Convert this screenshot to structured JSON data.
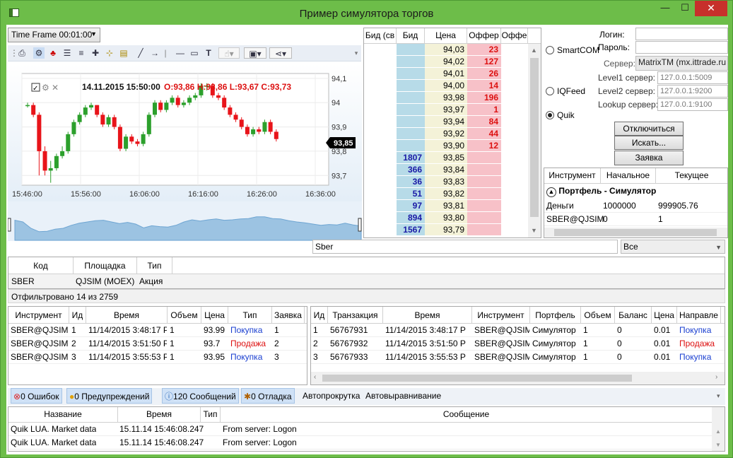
{
  "window": {
    "title": "Пример симулятора торгов",
    "min": "—",
    "max": "☐",
    "close": "✕"
  },
  "timeframe": {
    "label": "Time Frame 00:01:00"
  },
  "chart": {
    "info_date": "14.11.2015 15:50:00",
    "info_ohlc": "O:93,86 H:93,86 L:93,67 C:93,73",
    "last_price": "93,85",
    "price_ticks": [
      "94,1",
      "94",
      "93,9",
      "93,8",
      "93,7"
    ],
    "time_ticks": [
      "15:46:00",
      "15:56:00",
      "16:06:00",
      "16:16:00",
      "16:26:00",
      "16:36:00"
    ]
  },
  "chart_data": {
    "type": "candlestick",
    "x": [
      "15:46",
      "15:47",
      "15:48",
      "15:49",
      "15:50",
      "15:51",
      "15:52",
      "15:53",
      "15:54",
      "15:55",
      "15:56",
      "15:57",
      "15:58",
      "15:59",
      "16:00",
      "16:01",
      "16:02",
      "16:03",
      "16:04",
      "16:05",
      "16:06",
      "16:07",
      "16:08",
      "16:09",
      "16:10",
      "16:11",
      "16:12",
      "16:13",
      "16:14",
      "16:15",
      "16:16",
      "16:17",
      "16:18",
      "16:19",
      "16:20",
      "16:21",
      "16:22",
      "16:23",
      "16:24",
      "16:25",
      "16:26",
      "16:27",
      "16:28",
      "16:29"
    ],
    "open": [
      93.99,
      93.99,
      93.95,
      93.8,
      93.72,
      93.73,
      93.78,
      93.8,
      93.87,
      93.92,
      93.95,
      93.98,
      93.99,
      93.95,
      93.91,
      93.94,
      93.9,
      93.81,
      93.86,
      93.84,
      93.83,
      93.87,
      93.95,
      94.0,
      93.97,
      94.0,
      94.02,
      93.99,
      94.0,
      94.02,
      94.03,
      94.07,
      94.07,
      94.03,
      94.02,
      93.98,
      93.95,
      93.93,
      93.9,
      93.87,
      93.89,
      93.88,
      93.92,
      93.88
    ],
    "close": [
      93.99,
      93.95,
      93.8,
      93.72,
      93.73,
      93.78,
      93.8,
      93.87,
      93.92,
      93.95,
      93.98,
      93.99,
      93.95,
      93.91,
      93.94,
      93.9,
      93.81,
      93.86,
      93.84,
      93.83,
      93.87,
      93.95,
      94.0,
      93.97,
      94.0,
      94.02,
      93.99,
      94.0,
      94.02,
      94.03,
      94.07,
      94.07,
      94.03,
      94.02,
      93.98,
      93.95,
      93.93,
      93.9,
      93.87,
      93.89,
      93.88,
      93.92,
      93.88,
      93.85
    ],
    "high": [
      94.0,
      94.0,
      93.96,
      93.82,
      93.76,
      93.79,
      93.82,
      93.88,
      93.93,
      93.96,
      93.99,
      94.0,
      93.99,
      93.96,
      93.95,
      93.95,
      93.91,
      93.87,
      93.87,
      93.85,
      93.88,
      93.96,
      94.01,
      94.01,
      94.01,
      94.03,
      94.03,
      94.01,
      94.03,
      94.04,
      94.08,
      94.08,
      94.08,
      94.04,
      94.03,
      93.99,
      93.96,
      93.94,
      93.91,
      93.9,
      93.9,
      93.93,
      93.93,
      93.89
    ],
    "low": [
      93.98,
      93.94,
      93.7,
      93.7,
      93.67,
      93.72,
      93.77,
      93.79,
      93.86,
      93.91,
      93.94,
      93.97,
      93.94,
      93.9,
      93.9,
      93.89,
      93.8,
      93.8,
      93.83,
      93.82,
      93.82,
      93.86,
      93.94,
      93.96,
      93.96,
      93.99,
      93.98,
      93.98,
      93.99,
      94.01,
      94.02,
      94.05,
      94.02,
      94.01,
      93.97,
      93.94,
      93.92,
      93.89,
      93.86,
      93.86,
      93.87,
      93.87,
      93.87,
      93.84
    ],
    "ylim": [
      93.66,
      94.12
    ]
  },
  "orderbook": {
    "columns": [
      "Бид (св",
      "Бид",
      "Цена",
      "Оффер",
      "Оффе"
    ],
    "rows": [
      {
        "bid": "",
        "price": "94,03",
        "offer": "23"
      },
      {
        "bid": "",
        "price": "94,02",
        "offer": "127"
      },
      {
        "bid": "",
        "price": "94,01",
        "offer": "26"
      },
      {
        "bid": "",
        "price": "94,00",
        "offer": "14"
      },
      {
        "bid": "",
        "price": "93,98",
        "offer": "196"
      },
      {
        "bid": "",
        "price": "93,97",
        "offer": "1"
      },
      {
        "bid": "",
        "price": "93,94",
        "offer": "84"
      },
      {
        "bid": "",
        "price": "93,92",
        "offer": "44"
      },
      {
        "bid": "",
        "price": "93,90",
        "offer": "12"
      },
      {
        "bid": "1807",
        "price": "93,85",
        "offer": ""
      },
      {
        "bid": "366",
        "price": "93,84",
        "offer": ""
      },
      {
        "bid": "36",
        "price": "93,83",
        "offer": ""
      },
      {
        "bid": "51",
        "price": "93,82",
        "offer": ""
      },
      {
        "bid": "97",
        "price": "93,81",
        "offer": ""
      },
      {
        "bid": "894",
        "price": "93,80",
        "offer": ""
      },
      {
        "bid": "1567",
        "price": "93,79",
        "offer": ""
      }
    ]
  },
  "connection": {
    "login_label": "Логин:",
    "password_label": "Пароль:",
    "server_label": "Сервер:",
    "server_value": "MatrixTM (mx.ittrade.ru",
    "smartcom": "SmartCOM",
    "iqfeed": "IQFeed",
    "quik": "Quik",
    "level1_label": "Level1 сервер:",
    "level1_value": "127.0.0.1:5009",
    "level2_label": "Level2 сервер:",
    "level2_value": "127.0.0.1:9200",
    "lookup_label": "Lookup сервер:",
    "lookup_value": "127.0.0.1:9100",
    "disconnect": "Отключиться",
    "find": "Искать...",
    "order": "Заявка"
  },
  "portfolio": {
    "columns": [
      "Инструмент",
      "Начальное",
      "Текущее"
    ],
    "group": "Портфель - Симулятор",
    "rows": [
      [
        "Деньги",
        "1000000",
        "999905.76"
      ],
      [
        "SBER@QJSIM",
        "0",
        "1"
      ]
    ]
  },
  "search": {
    "value": "Sber",
    "filter": "Все"
  },
  "securities": {
    "columns": [
      "Код",
      "Площадка",
      "Тип"
    ],
    "rows": [
      [
        "SBER",
        "QJSIM (MOEX)",
        "Акция"
      ]
    ],
    "status": "Отфильтровано 14 из 2759"
  },
  "orders": {
    "columns": [
      "Инструмент",
      "Ид",
      "Время",
      "Объем",
      "Цена",
      "Тип",
      "Заявка"
    ],
    "rows": [
      [
        "SBER@QJSIM",
        "1",
        "11/14/2015 3:48:17 P",
        "1",
        "93.99",
        "Покупка",
        "1"
      ],
      [
        "SBER@QJSIM",
        "2",
        "11/14/2015 3:51:50 P",
        "1",
        "93.7",
        "Продажа",
        "2"
      ],
      [
        "SBER@QJSIM",
        "3",
        "11/14/2015 3:55:53 P",
        "1",
        "93.95",
        "Покупка",
        "3"
      ]
    ]
  },
  "trades": {
    "columns": [
      "Ид",
      "Транзакция",
      "Время",
      "Инструмент",
      "Портфель",
      "Объем",
      "Баланс",
      "Цена",
      "Направле"
    ],
    "rows": [
      [
        "1",
        "56767931",
        "11/14/2015 3:48:17 P",
        "SBER@QJSIM",
        "Симулятор",
        "1",
        "0",
        "0.01",
        "Покупка"
      ],
      [
        "2",
        "56767932",
        "11/14/2015 3:51:50 P",
        "SBER@QJSIM",
        "Симулятор",
        "1",
        "0",
        "0.01",
        "Продажа"
      ],
      [
        "3",
        "56767933",
        "11/14/2015 3:55:53 P",
        "SBER@QJSIM",
        "Симулятор",
        "1",
        "0",
        "0.01",
        "Покупка"
      ]
    ]
  },
  "log": {
    "tabs": {
      "errors": "0 Ошибок",
      "warnings": "0 Предупреждений",
      "messages": "120 Сообщений",
      "debug": "0 Отладка",
      "autoscroll": "Автопрокрутка",
      "autoalign": "Автовыравнивание"
    },
    "columns": [
      "Название",
      "Время",
      "Тип",
      "Сообщение"
    ],
    "rows": [
      [
        "Quik LUA. Market data",
        "15.11.14 15:46:08.247",
        "",
        "From server: Logon"
      ],
      [
        "Quik LUA. Market data",
        "15.11.14 15:46:08.247",
        "",
        "From server: Logon"
      ]
    ]
  },
  "colors": {
    "up": "#2ca02c",
    "down": "#e8141a",
    "offer_bg": "#f7c1c8",
    "bid_bg": "#b7dbe8",
    "price_bg": "#f4f2d8"
  }
}
